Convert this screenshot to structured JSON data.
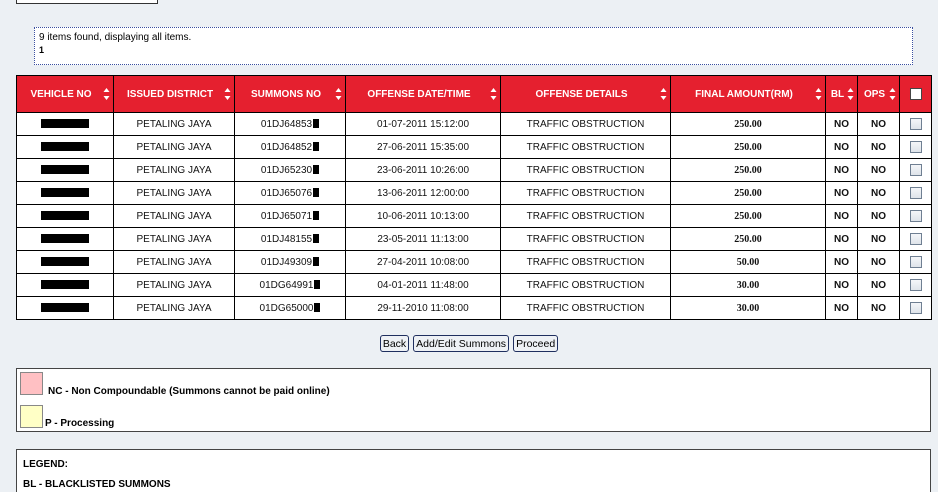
{
  "results": {
    "found_text": "9 items found, displaying all items.",
    "page_number": "1"
  },
  "table": {
    "headers": {
      "vehicle_no": "VEHICLE NO",
      "issued_district": "ISSUED DISTRICT",
      "summons_no": "SUMMONS NO",
      "offense_datetime": "OFFENSE DATE/TIME",
      "offense_details": "OFFENSE DETAILS",
      "final_amount": "FINAL AMOUNT(RM)",
      "bl": "BL",
      "ops": "OPS"
    },
    "rows": [
      {
        "district": "PETALING JAYA",
        "summons": "01DJ64853",
        "datetime": "01-07-2011 15:12:00",
        "details": "TRAFFIC OBSTRUCTION",
        "amount": "250.00",
        "bl": "NO",
        "ops": "NO"
      },
      {
        "district": "PETALING JAYA",
        "summons": "01DJ64852",
        "datetime": "27-06-2011 15:35:00",
        "details": "TRAFFIC OBSTRUCTION",
        "amount": "250.00",
        "bl": "NO",
        "ops": "NO"
      },
      {
        "district": "PETALING JAYA",
        "summons": "01DJ65230",
        "datetime": "23-06-2011 10:26:00",
        "details": "TRAFFIC OBSTRUCTION",
        "amount": "250.00",
        "bl": "NO",
        "ops": "NO"
      },
      {
        "district": "PETALING JAYA",
        "summons": "01DJ65076",
        "datetime": "13-06-2011 12:00:00",
        "details": "TRAFFIC OBSTRUCTION",
        "amount": "250.00",
        "bl": "NO",
        "ops": "NO"
      },
      {
        "district": "PETALING JAYA",
        "summons": "01DJ65071",
        "datetime": "10-06-2011 10:13:00",
        "details": "TRAFFIC OBSTRUCTION",
        "amount": "250.00",
        "bl": "NO",
        "ops": "NO"
      },
      {
        "district": "PETALING JAYA",
        "summons": "01DJ48155",
        "datetime": "23-05-2011 11:13:00",
        "details": "TRAFFIC OBSTRUCTION",
        "amount": "250.00",
        "bl": "NO",
        "ops": "NO"
      },
      {
        "district": "PETALING JAYA",
        "summons": "01DJ49309",
        "datetime": "27-04-2011 10:08:00",
        "details": "TRAFFIC OBSTRUCTION",
        "amount": "50.00",
        "bl": "NO",
        "ops": "NO"
      },
      {
        "district": "PETALING JAYA",
        "summons": "01DG64991",
        "datetime": "04-01-2011 11:48:00",
        "details": "TRAFFIC OBSTRUCTION",
        "amount": "30.00",
        "bl": "NO",
        "ops": "NO"
      },
      {
        "district": "PETALING JAYA",
        "summons": "01DG65000",
        "datetime": "29-11-2010 11:08:00",
        "details": "TRAFFIC OBSTRUCTION",
        "amount": "30.00",
        "bl": "NO",
        "ops": "NO"
      }
    ]
  },
  "buttons": {
    "back": "Back",
    "add_edit": "Add/Edit Summons",
    "proceed": "Proceed"
  },
  "status_legend": {
    "nc": "NC - Non Compoundable (Summons cannot be paid online)",
    "p": "P - Processing"
  },
  "legend": {
    "title": "LEGEND:",
    "bl": "BL - BLACKLISTED SUMMONS"
  },
  "colors": {
    "header_red": "#e5202f",
    "amount_red": "#cc0000",
    "nc_pink": "#ffc0c3",
    "processing_yellow": "#ffffc6"
  }
}
